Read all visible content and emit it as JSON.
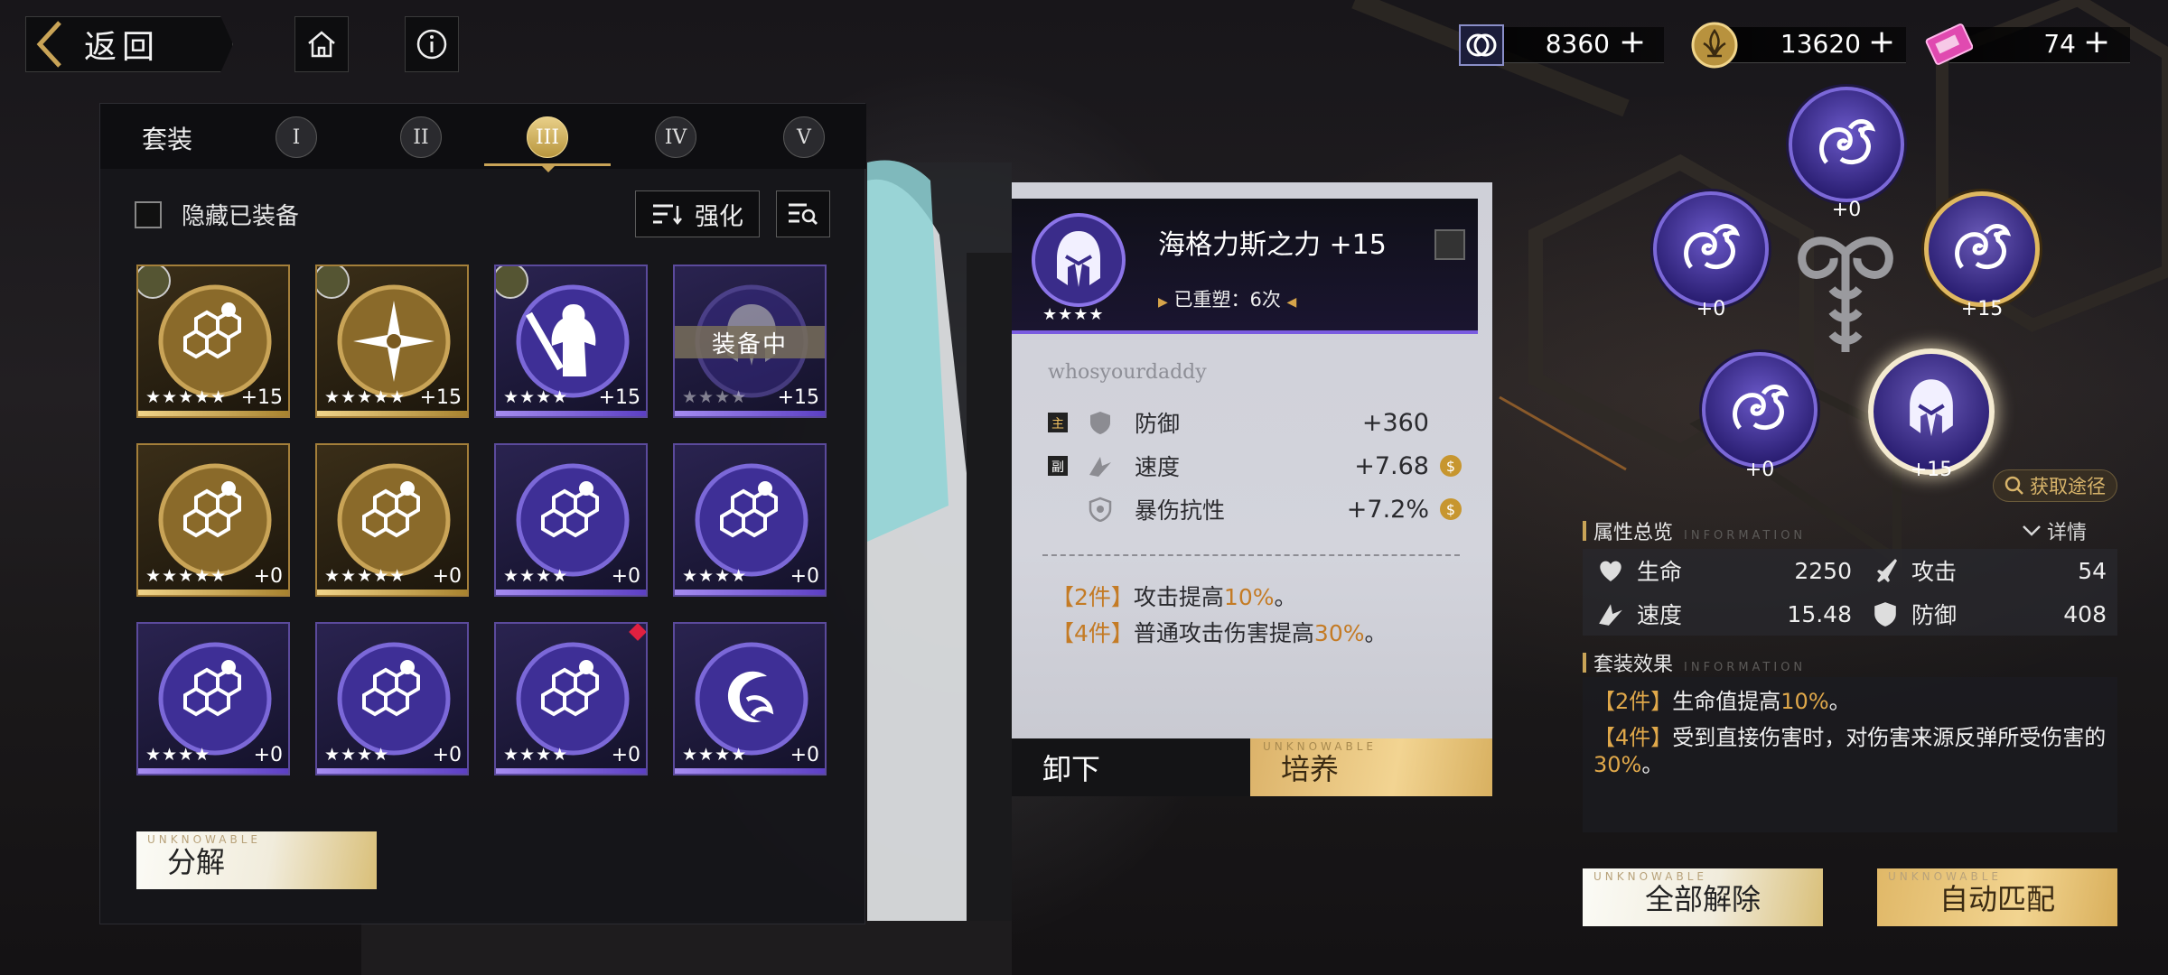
{
  "topbar": {
    "back_label": "返回",
    "currencies": [
      {
        "icon": "gem-currency-icon",
        "value": "8360"
      },
      {
        "icon": "fleur-coin-icon",
        "value": "13620"
      },
      {
        "icon": "ticket-icon",
        "value": "74"
      }
    ],
    "plus": "+"
  },
  "left_panel": {
    "title": "套装",
    "tabs": [
      "I",
      "II",
      "III",
      "IV",
      "V"
    ],
    "active_tab": "III",
    "hide_equipped_label": "隐藏已装备",
    "enhance_label": "强化",
    "equipped_label": "装备中",
    "decompose_label": "分解",
    "decompose_tag": "UNKNOWABLE",
    "cards": [
      {
        "tier": "gold",
        "stars": "★★★★★",
        "level": "+15",
        "avatar": true,
        "icon": "honeycomb-icon"
      },
      {
        "tier": "gold",
        "stars": "★★★★★",
        "level": "+15",
        "avatar": true,
        "icon": "shuriken-icon"
      },
      {
        "tier": "purple",
        "stars": "★★★★",
        "level": "+15",
        "avatar": true,
        "icon": "warrior-icon"
      },
      {
        "tier": "purple",
        "stars": "★★★★",
        "level": "+15",
        "equipped": true,
        "icon": "helmet-icon"
      },
      {
        "tier": "gold",
        "stars": "★★★★★",
        "level": "+0",
        "icon": "honeycomb-icon"
      },
      {
        "tier": "gold",
        "stars": "★★★★★",
        "level": "+0",
        "icon": "honeycomb-icon"
      },
      {
        "tier": "purple",
        "stars": "★★★★",
        "level": "+0",
        "icon": "honeycomb-icon"
      },
      {
        "tier": "purple",
        "stars": "★★★★",
        "level": "+0",
        "icon": "honeycomb-icon"
      },
      {
        "tier": "purple",
        "stars": "★★★★",
        "level": "+0",
        "icon": "honeycomb-icon"
      },
      {
        "tier": "purple",
        "stars": "★★★★",
        "level": "+0",
        "icon": "honeycomb-icon"
      },
      {
        "tier": "purple",
        "stars": "★★★★",
        "level": "+0",
        "icon": "honeycomb-icon",
        "new": true
      },
      {
        "tier": "purple",
        "stars": "★★★★",
        "level": "+0",
        "icon": "crescent-icon"
      }
    ]
  },
  "detail": {
    "name": "海格力斯之力 +15",
    "refine_label": "已重塑：6次",
    "stars": "★★★★",
    "owner": "whosyourdaddy",
    "stats": [
      {
        "tag": "主",
        "name": "防御",
        "value": "+360",
        "icon": "shield-icon",
        "coin": false
      },
      {
        "tag": "副",
        "name": "速度",
        "value": "+7.68",
        "icon": "speed-icon",
        "coin": true
      },
      {
        "tag": "",
        "name": "暴伤抗性",
        "value": "+7.2%",
        "icon": "crit-resist-icon",
        "coin": true
      }
    ],
    "effects": [
      {
        "bracket": "【2件】",
        "pre": "攻击提高",
        "hl": "10%",
        "post": "。"
      },
      {
        "bracket": "【4件】",
        "pre": "普通攻击伤害提高",
        "hl": "30%",
        "post": "。"
      }
    ],
    "unequip_label": "卸下",
    "train_label": "培养",
    "train_tag": "UNKNOWABLE"
  },
  "slots": {
    "levels": [
      "+0",
      "+0",
      "+15",
      "+0",
      "+15"
    ],
    "acquire_label": "获取途径"
  },
  "attributes": {
    "title": "属性总览",
    "en": "INFORMATION",
    "detail_label": "详情",
    "items": [
      {
        "name": "生命",
        "value": "2250",
        "icon": "heart-icon"
      },
      {
        "name": "攻击",
        "value": "54",
        "icon": "sword-icon"
      },
      {
        "name": "速度",
        "value": "15.48",
        "icon": "speed-icon"
      },
      {
        "name": "防御",
        "value": "408",
        "icon": "shield-icon"
      }
    ]
  },
  "set_effect": {
    "title": "套装效果",
    "en": "INFORMATION",
    "lines": [
      {
        "bracket": "【2件】",
        "pre": "生命值提高",
        "hl": "10%",
        "post": "。"
      },
      {
        "bracket": "【4件】",
        "pre": "受到直接伤害时，对伤害来源反弹所受伤害的",
        "hl": "30%",
        "post": "。"
      }
    ]
  },
  "actions": {
    "unequip_all_label": "全部解除",
    "auto_match_label": "自动匹配",
    "tag": "UNKNOWABLE"
  },
  "colors": {
    "gold_accent": "#c9a457",
    "purple_accent": "#7a5ce0",
    "highlight_orange": "#c47b25"
  }
}
